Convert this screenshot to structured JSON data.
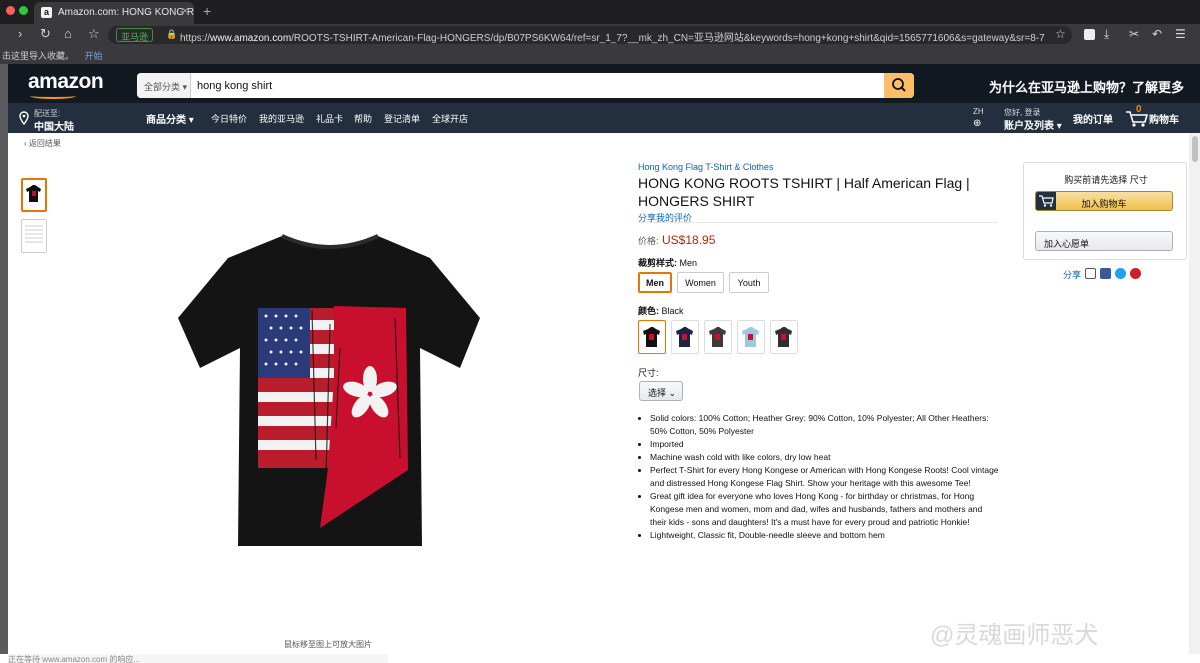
{
  "browser": {
    "tab_title": "Amazon.com: HONG KONG RO",
    "tab_favicon": "a",
    "tab_close": "×",
    "new_tab": "+",
    "url_badge": "亚马逊",
    "url_scheme": "https://",
    "url_host": "www.amazon.com",
    "url_path": "/ROOTS-TSHIRT-American-Flag-HONGERS/dp/B07PS6KW64/ref=sr_1_7?__mk_zh_CN=亚马逊网站&keywords=hong+kong+shirt&qid=1565771606&s=gateway&sr=8-7",
    "bookmarks_hint": "击这里导入收藏。",
    "bookmarks_link": "开始",
    "status": "正在等待 www.amazon.com 的响应..."
  },
  "header": {
    "logo": "amazon",
    "search_category": "全部分类",
    "search_value": "hong kong shirt",
    "promo": "为什么在亚马逊上购物？了解更多",
    "deliver_small": "配送至:",
    "deliver_big": "中国大陆",
    "nav_items": [
      "商品分类",
      "今日特价",
      "我的亚马逊",
      "礼品卡",
      "帮助",
      "登记清单",
      "全球开店"
    ],
    "lang_small": "ZH",
    "lang_big": "⊕",
    "account_small": "您好, 登录",
    "account_big": "账户及列表",
    "orders": "我的订单",
    "cart_count": "0",
    "cart_label": "购物车"
  },
  "page": {
    "back_link": "‹ 返回结果",
    "hover_hint": "鼠标移至图上可放大图片",
    "brand": "Hong Kong Flag T-Shirt & Clothes",
    "title": "HONG KONG ROOTS TSHIRT | Half American Flag | HONGERS SHIRT",
    "share_review": "分享我的评价",
    "price_label": "价格:",
    "price": "US$18.95",
    "fit_label": "裁剪样式:",
    "fit_value": "Men",
    "fit_options": [
      "Men",
      "Women",
      "Youth"
    ],
    "color_label": "颜色:",
    "color_value": "Black",
    "size_label": "尺寸:",
    "size_select": "选择",
    "bullets": [
      "Solid colors: 100% Cotton; Heather Grey: 90% Cotton, 10% Polyester; All Other Heathers: 50% Cotton, 50% Polyester",
      "Imported",
      "Machine wash cold with like colors, dry low heat",
      "Perfect T-Shirt for every Hong Kongese or American with Hong Kongese Roots! Cool vintage and distressed Hong Kongese Flag Shirt. Show your heritage with this awesome Tee!",
      "Great gift idea for everyone who loves Hong Kong - for birthday or christmas, for Hong Kongese men and women, mom and dad, wifes and husbands, fathers and mothers and their kids - sons and daughters! It's a must have for every proud and patriotic Honkie!",
      "Lightweight, Classic fit, Double-needle sleeve and bottom hem"
    ]
  },
  "buybox": {
    "hint": "购买前请先选择 尺寸",
    "add_to_cart": "加入购物车",
    "wishlist": "加入心愿单",
    "share": "分享"
  },
  "watermark": "@灵魂画师恶犬",
  "colors": {
    "amazon_dark": "#131921",
    "amazon_nav": "#232f3e",
    "amazon_orange": "#febd69",
    "price_red": "#b12704",
    "link_blue": "#0066c0"
  }
}
